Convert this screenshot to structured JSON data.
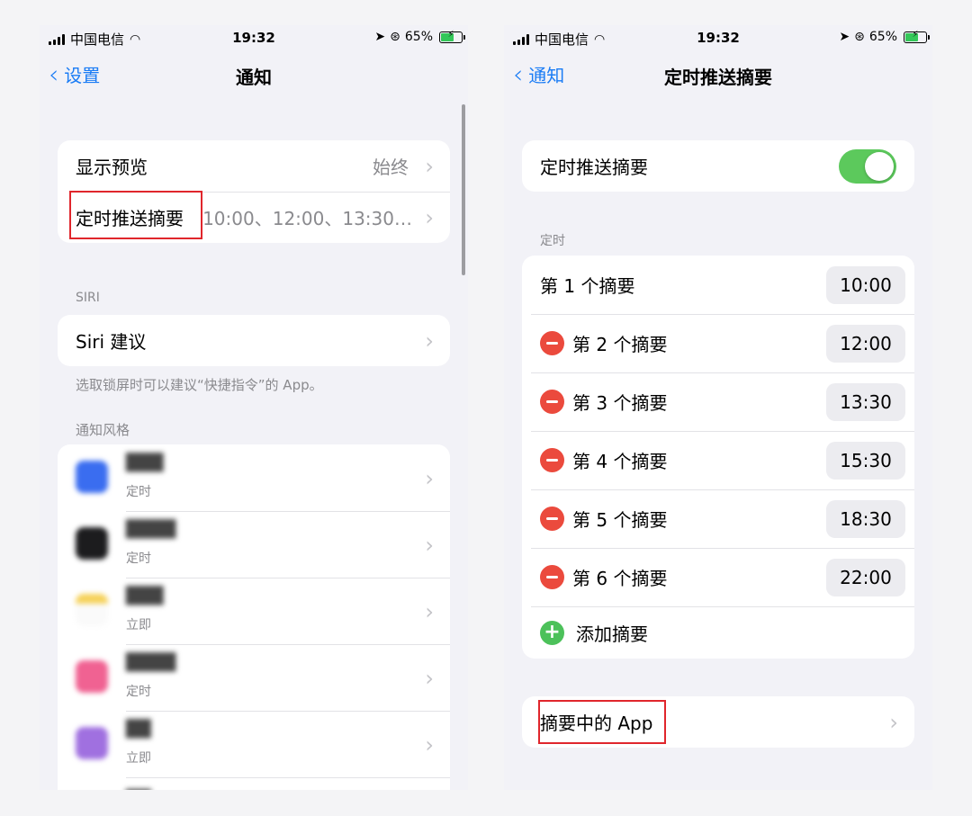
{
  "status_bar": {
    "carrier": "中国电信",
    "time": "19:32",
    "battery": "65%",
    "battery_level": 0.65
  },
  "left": {
    "nav": {
      "back_label": "设置",
      "title": "通知"
    },
    "preview_group": {
      "show_preview_label": "显示预览",
      "show_preview_value": "始终",
      "scheduled_summary_label": "定时推送摘要",
      "scheduled_summary_value": "10:00、12:00、13:30…"
    },
    "siri": {
      "section_label": "SIRI",
      "suggestions_label": "Siri 建议",
      "note": "选取锁屏时可以建议“快捷指令”的 App。"
    },
    "style": {
      "section_label": "通知风格",
      "apps": [
        {
          "name": "",
          "mode": "定时",
          "color": "#3a6df0"
        },
        {
          "name": "",
          "mode": "定时",
          "color": "#1c1c1e"
        },
        {
          "name": "",
          "mode": "立即",
          "color": "#f6d25a"
        },
        {
          "name": "",
          "mode": "定时",
          "color": "#f06292"
        },
        {
          "name": "",
          "mode": "立即",
          "color": "#a070e0"
        }
      ]
    }
  },
  "right": {
    "nav": {
      "back_label": "通知",
      "title": "定时推送摘要"
    },
    "toggle": {
      "label": "定时推送摘要",
      "on": true
    },
    "schedule": {
      "section_label": "定时",
      "items": [
        {
          "label": "第 1 个摘要",
          "time": "10:00"
        },
        {
          "label": "第 2 个摘要",
          "time": "12:00"
        },
        {
          "label": "第 3 个摘要",
          "time": "13:30"
        },
        {
          "label": "第 4 个摘要",
          "time": "15:30"
        },
        {
          "label": "第 5 个摘要",
          "time": "18:30"
        },
        {
          "label": "第 6 个摘要",
          "time": "22:00"
        }
      ],
      "add_label": "添加摘要"
    },
    "apps_in_summary_label": "摘要中的 App"
  },
  "colors": {
    "accent": "#1a7cf5",
    "toggle_on": "#5cc95c",
    "delete": "#eb4a3d",
    "add": "#4cc15a",
    "highlight": "#e0262c"
  }
}
